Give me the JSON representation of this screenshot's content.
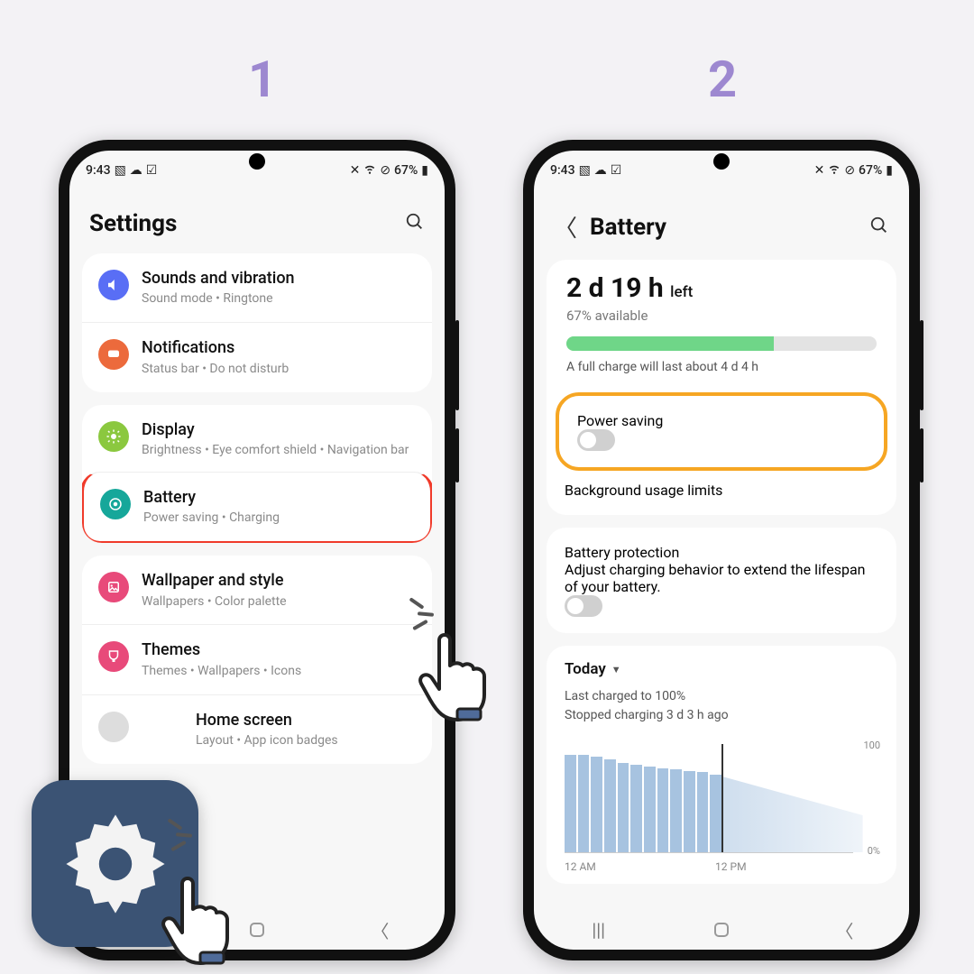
{
  "step_labels": [
    "1",
    "2"
  ],
  "statusbar": {
    "time": "9:43",
    "battery": "67%"
  },
  "screen1": {
    "title": "Settings",
    "group1": [
      {
        "icon": "sound-icon",
        "title": "Sounds and vibration",
        "sub": "Sound mode  •  Ringtone"
      },
      {
        "icon": "notification-icon",
        "title": "Notifications",
        "sub": "Status bar  •  Do not disturb"
      }
    ],
    "group2": [
      {
        "icon": "display-icon",
        "title": "Display",
        "sub": "Brightness  •  Eye comfort shield  •  Navigation bar"
      },
      {
        "icon": "battery-icon",
        "title": "Battery",
        "sub": "Power saving  •  Charging",
        "highlight": true
      }
    ],
    "group3": [
      {
        "icon": "wallpaper-icon",
        "title": "Wallpaper and style",
        "sub": "Wallpapers  •  Color palette"
      },
      {
        "icon": "themes-icon",
        "title": "Themes",
        "sub": "Themes  •  Wallpapers  •  Icons"
      },
      {
        "icon": "home-icon",
        "title": "Home screen",
        "sub": "Layout  •  App icon badges",
        "obscured": true
      }
    ]
  },
  "screen2": {
    "title": "Battery",
    "time_left": "2 d 19 h",
    "time_suffix": "left",
    "available": "67% available",
    "progress_percent": 67,
    "full_charge": "A full charge will last about 4 d 4 h",
    "power_saving": "Power saving",
    "bg_limits": "Background usage limits",
    "protection_title": "Battery protection",
    "protection_sub": "Adjust charging behavior to extend the lifespan of your battery.",
    "today": "Today",
    "last_charged": "Last charged to 100%",
    "stopped": "Stopped charging 3 d 3 h ago",
    "chart": {
      "y_top": "100",
      "y_bottom": "0%",
      "x_left": "12 AM",
      "x_right": "12 PM"
    }
  }
}
